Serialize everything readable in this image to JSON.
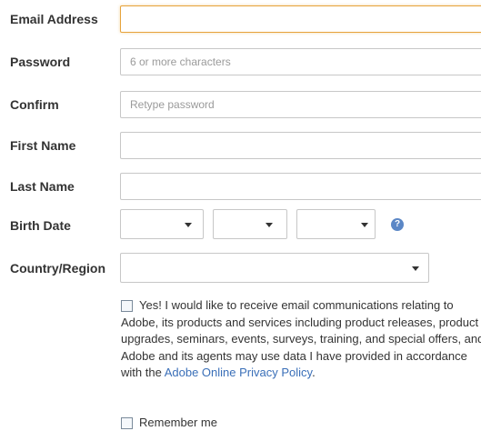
{
  "form": {
    "email_label": "Email Address",
    "password_label": "Password",
    "password_placeholder": "6 or more characters",
    "confirm_label": "Confirm",
    "confirm_placeholder": "Retype password",
    "first_name_label": "First Name",
    "last_name_label": "Last Name",
    "birth_date_label": "Birth Date",
    "help_symbol": "?",
    "country_label": "Country/Region"
  },
  "consent": {
    "text": "Yes! I would like to receive email communications relating to Adobe, its products and services including product releases, product upgrades, seminars, events, surveys, training, and special offers, and Adobe and its agents may use data I have provided in accordance with the",
    "link_text": "Adobe Online Privacy Policy",
    "period": "."
  },
  "remember": {
    "label": "Remember me"
  },
  "colors": {
    "focus_border": "#e6a33c",
    "link": "#3a6fb8",
    "help_icon": "#5b87c6"
  }
}
